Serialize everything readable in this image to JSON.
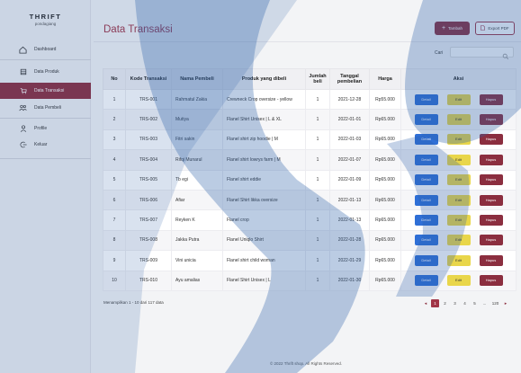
{
  "brand": {
    "name": "THRIFT",
    "tagline": "pondagiang"
  },
  "sidebar": {
    "items": [
      {
        "label": "Dashboard",
        "icon": "home-icon",
        "active": false
      },
      {
        "label": "Data Produk",
        "icon": "box-icon",
        "active": false
      },
      {
        "label": "Data Transaksi",
        "icon": "cart-icon",
        "active": true
      },
      {
        "label": "Data Pembeli",
        "icon": "users-icon",
        "active": false
      },
      {
        "label": "Profile",
        "icon": "user-icon",
        "active": false
      },
      {
        "label": "Keluar",
        "icon": "logout-icon",
        "active": false
      }
    ]
  },
  "header": {
    "title": "Data Transaksi",
    "add_label": "Tambah",
    "export_label": "Export PDF"
  },
  "search": {
    "label": "Cari",
    "value": "",
    "placeholder": ""
  },
  "table": {
    "columns": [
      "No",
      "Kode Transaksi",
      "Nama Pembeli",
      "Produk yang dibeli",
      "Jumlah beli",
      "Tanggal pembelian",
      "Harga",
      "Aksi"
    ],
    "action_labels": {
      "detail": "Detail",
      "edit": "Edit",
      "hapus": "Hapus"
    },
    "rows": [
      {
        "no": "1",
        "kode": "TRS-001",
        "nama": "Rahmatul Zakia",
        "produk": "Crewneck Crop oversize - yellow",
        "jumlah": "1",
        "tanggal": "2021-12-28",
        "harga": "Rp55.000"
      },
      {
        "no": "2",
        "kode": "TRS-002",
        "nama": "Mutiya",
        "produk": "Flanel Shirt Unisex | L & XL",
        "jumlah": "1",
        "tanggal": "2022-01-01",
        "harga": "Rp65.000"
      },
      {
        "no": "3",
        "kode": "TRS-003",
        "nama": "Fitri sakin",
        "produk": "Flanel shirt zip hoodie | M",
        "jumlah": "1",
        "tanggal": "2022-01-03",
        "harga": "Rp65.000"
      },
      {
        "no": "4",
        "kode": "TRS-004",
        "nama": "Rifqi Munarul",
        "produk": "Flanel shirt lowrys farm | M",
        "jumlah": "1",
        "tanggal": "2022-01-07",
        "harga": "Rp65.000"
      },
      {
        "no": "5",
        "kode": "TRS-005",
        "nama": "Tb egi",
        "produk": "Flanel shirt eddie",
        "jumlah": "1",
        "tanggal": "2022-01-09",
        "harga": "Rp65.000"
      },
      {
        "no": "6",
        "kode": "TRS-006",
        "nama": "Afiar",
        "produk": "Flanel Shirt likka oversize",
        "jumlah": "1",
        "tanggal": "2022-01-13",
        "harga": "Rp65.000"
      },
      {
        "no": "7",
        "kode": "TRS-007",
        "nama": "Reyken K",
        "produk": "Flanel crop",
        "jumlah": "1",
        "tanggal": "2022-01-13",
        "harga": "Rp65.000"
      },
      {
        "no": "8",
        "kode": "TRS-008",
        "nama": "Jakka Putra",
        "produk": "Flanel Uniqlo Shirt",
        "jumlah": "1",
        "tanggal": "2022-01-28",
        "harga": "Rp65.000"
      },
      {
        "no": "9",
        "kode": "TRS-009",
        "nama": "Vini unicia",
        "produk": "Flanel shirt child woman",
        "jumlah": "1",
        "tanggal": "2022-01-29",
        "harga": "Rp65.000"
      },
      {
        "no": "10",
        "kode": "TRS-010",
        "nama": "Ayu amalias",
        "produk": "Flanel Shirt Unisex | L",
        "jumlah": "1",
        "tanggal": "2022-01-30",
        "harga": "Rp65.000"
      }
    ]
  },
  "pagination": {
    "showing": "Menampilkan 1 - 10 dari 117 data",
    "pages": [
      "1",
      "2",
      "3",
      "4",
      "5",
      "...",
      "120"
    ],
    "active": "1",
    "prev": "◂",
    "next": "▸"
  },
  "footer": {
    "text": "© 2022 Thrift shop. All Rights Reserved."
  },
  "colors": {
    "accent": "#8b2e3f",
    "detail": "#2f6fd6",
    "edit": "#e9d64a",
    "watermark": "#2b5fa8"
  }
}
